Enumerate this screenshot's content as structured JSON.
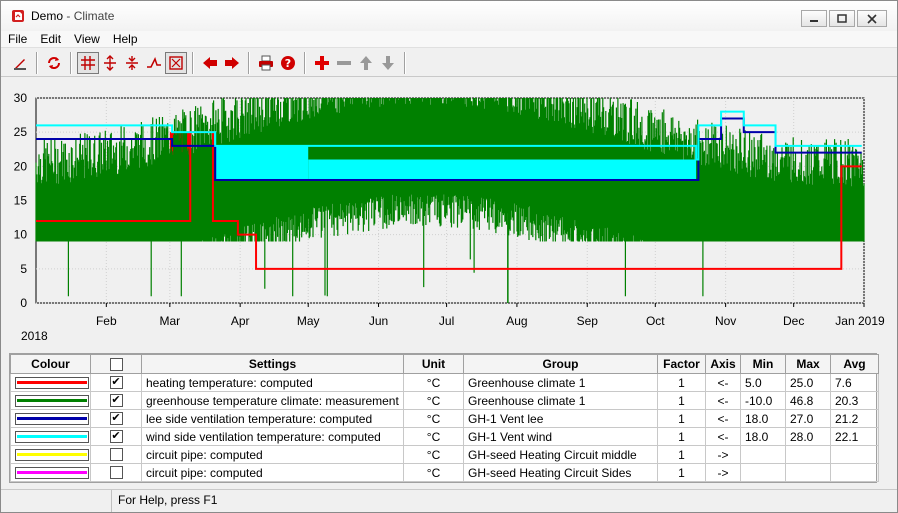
{
  "window": {
    "title_app": "Demo",
    "title_sep": " - ",
    "title_doc": "Climate"
  },
  "menu": [
    "File",
    "Edit",
    "View",
    "Help"
  ],
  "toolbar": {
    "icons": [
      "edit-icon",
      "refresh-icon",
      "grid-icon",
      "expand-vertical-icon",
      "compress-vertical-icon",
      "step-icon",
      "zoom-box-icon",
      "arrow-left-icon",
      "arrow-right-icon",
      "print-icon",
      "help-icon",
      "add-icon",
      "remove-icon",
      "move-up-icon",
      "move-down-icon"
    ]
  },
  "chart_data": {
    "type": "line",
    "year_label": "2018",
    "ylim": [
      0,
      30
    ],
    "y_ticks": [
      "0",
      "5",
      "10",
      "15",
      "20",
      "25",
      "30"
    ],
    "x_ticks": [
      "Feb",
      "Mar",
      "Apr",
      "May",
      "Jun",
      "Jul",
      "Aug",
      "Sep",
      "Oct",
      "Nov",
      "Dec",
      "Jan 2019"
    ],
    "grid": true,
    "series": [
      {
        "name": "heating temperature: computed",
        "color": "#ff0000",
        "points": [
          [
            "Jan 1",
            12
          ],
          [
            "Mar 1",
            12
          ],
          [
            "Mar 10",
            25
          ],
          [
            "Mar 20",
            12
          ],
          [
            "Mar 31",
            10
          ],
          [
            "Apr 8",
            5
          ],
          [
            "Nov 1",
            5
          ],
          [
            "Dec 20",
            5
          ],
          [
            "Dec 22",
            20
          ],
          [
            "Dec 31",
            20
          ]
        ]
      },
      {
        "name": "greenhouse temperature climate: measurement",
        "color": "#008000",
        "min": -10.0,
        "max": 46.8,
        "avg": 20.3
      },
      {
        "name": "lee side ventilation temperature: computed",
        "color": "#0000aa",
        "points": [
          [
            "Jan 1",
            24
          ],
          [
            "Mar 1",
            24
          ],
          [
            "Mar 2",
            23
          ],
          [
            "Mar 20",
            23
          ],
          [
            "Mar 21",
            18
          ],
          [
            "Oct 19",
            18
          ],
          [
            "Oct 20",
            24
          ],
          [
            "Oct 29",
            24
          ],
          [
            "Oct 30",
            27
          ],
          [
            "Nov 8",
            27
          ],
          [
            "Nov 9",
            25
          ],
          [
            "Nov 22",
            25
          ],
          [
            "Nov 23",
            22
          ],
          [
            "Dec 31",
            22
          ]
        ]
      },
      {
        "name": "wind side ventilation temperature: computed",
        "color": "#00ffff",
        "points": [
          [
            "Jan 1",
            26
          ],
          [
            "Mar 1",
            26
          ],
          [
            "Mar 2",
            25
          ],
          [
            "Mar 20",
            25
          ],
          [
            "Mar 21",
            23
          ],
          [
            "Oct 19",
            21
          ],
          [
            "Oct 20",
            26
          ],
          [
            "Oct 29",
            26
          ],
          [
            "Oct 30",
            28
          ],
          [
            "Nov 8",
            28
          ],
          [
            "Nov 9",
            26
          ],
          [
            "Nov 22",
            26
          ],
          [
            "Nov 23",
            23
          ],
          [
            "Dec 31",
            23
          ]
        ]
      }
    ]
  },
  "table": {
    "headers": [
      "Colour",
      "",
      "Settings",
      "Unit",
      "Group",
      "Factor",
      "Axis",
      "Min",
      "Max",
      "Avg"
    ],
    "rows": [
      {
        "color": "#ff0000",
        "checked": "✔",
        "settings": "heating temperature: computed",
        "unit": "°C",
        "group": "Greenhouse climate 1",
        "factor": "1",
        "axis": "<-",
        "min": "5.0",
        "max": "25.0",
        "avg": "7.6"
      },
      {
        "color": "#008000",
        "checked": "✔",
        "settings": "greenhouse temperature climate: measurement",
        "unit": "°C",
        "group": "Greenhouse climate 1",
        "factor": "1",
        "axis": "<-",
        "min": "-10.0",
        "max": "46.8",
        "avg": "20.3"
      },
      {
        "color": "#0000aa",
        "checked": "✔",
        "settings": "lee side ventilation temperature: computed",
        "unit": "°C",
        "group": "GH-1 Vent lee",
        "factor": "1",
        "axis": "<-",
        "min": "18.0",
        "max": "27.0",
        "avg": "21.2"
      },
      {
        "color": "#00ffff",
        "checked": "✔",
        "settings": "wind side ventilation temperature: computed",
        "unit": "°C",
        "group": "GH-1 Vent wind",
        "factor": "1",
        "axis": "<-",
        "min": "18.0",
        "max": "28.0",
        "avg": "22.1"
      },
      {
        "color": "#ffff00",
        "checked": "",
        "settings": "circuit pipe: computed",
        "unit": "°C",
        "group": "GH-seed Heating Circuit middle",
        "factor": "1",
        "axis": "->",
        "min": "",
        "max": "",
        "avg": ""
      },
      {
        "color": "#ff00ff",
        "checked": "",
        "settings": "circuit pipe: computed",
        "unit": "°C",
        "group": "GH-seed Heating Circuit Sides",
        "factor": "1",
        "axis": "->",
        "min": "",
        "max": "",
        "avg": ""
      }
    ]
  },
  "status": {
    "text": "For Help, press F1"
  }
}
